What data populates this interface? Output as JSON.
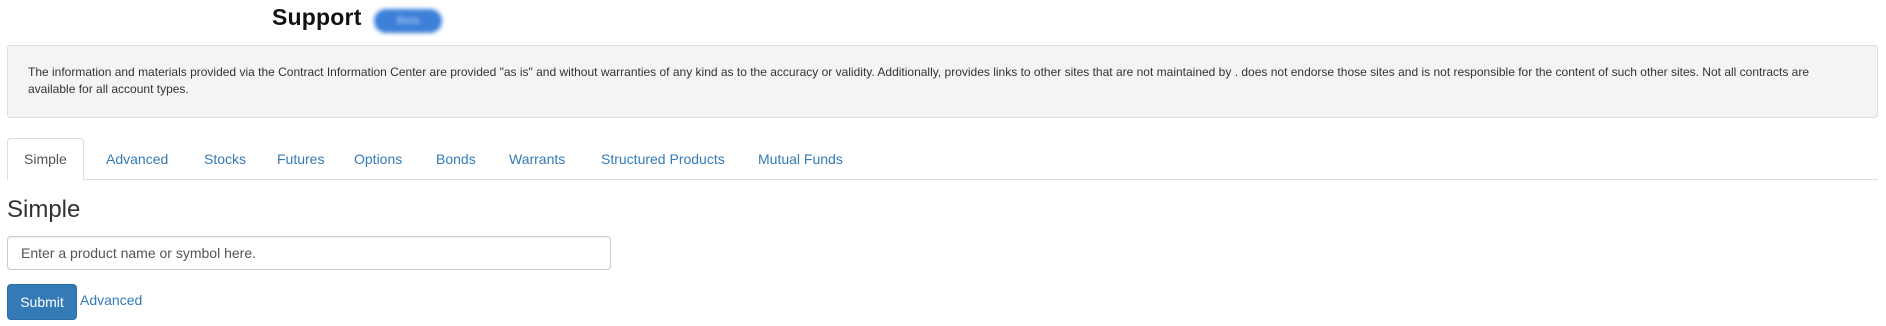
{
  "header": {
    "title": "Support",
    "badge_text": "Beta"
  },
  "disclaimer": {
    "text": "The information and materials provided via the Contract Information Center are provided \"as is\" and without warranties of any kind as to the accuracy or validity. Additionally, provides links to other sites that are not maintained by . does not endorse those sites and is not responsible for the content of such other sites. Not all contracts are available for all account types."
  },
  "tabs": [
    {
      "label": "Simple",
      "active": true
    },
    {
      "label": "Advanced",
      "active": false
    },
    {
      "label": "Stocks",
      "active": false
    },
    {
      "label": "Futures",
      "active": false
    },
    {
      "label": "Options",
      "active": false
    },
    {
      "label": "Bonds",
      "active": false
    },
    {
      "label": "Warrants",
      "active": false
    },
    {
      "label": "Structured Products",
      "active": false
    },
    {
      "label": "Mutual Funds",
      "active": false
    }
  ],
  "main": {
    "heading": "Simple",
    "search_placeholder": "Enter a product name or symbol here.",
    "search_value": "",
    "submit_label": "Submit",
    "advanced_link_label": "Advanced"
  },
  "colors": {
    "link": "#337ab7",
    "primary_button": "#337ab7",
    "disclaimer_bg": "#f4f4f4",
    "badge": "#3d7fd9"
  }
}
